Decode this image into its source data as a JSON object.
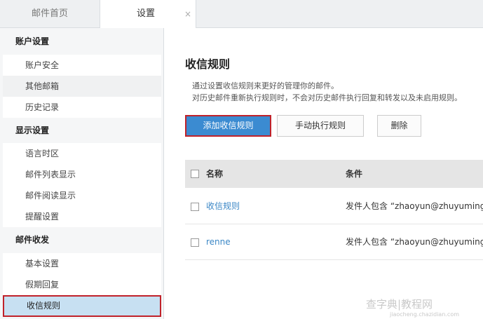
{
  "tabs": {
    "home": "邮件首页",
    "settings": "设置",
    "close_glyph": "×"
  },
  "sidebar": {
    "groups": [
      {
        "heading": "账户设置",
        "items": [
          "账户安全",
          "其他邮箱",
          "历史记录"
        ]
      },
      {
        "heading": "显示设置",
        "items": [
          "语言时区",
          "邮件列表显示",
          "邮件阅读显示",
          "提醒设置"
        ]
      },
      {
        "heading": "邮件收发",
        "items": [
          "基本设置",
          "假期回复",
          "收信规则"
        ]
      }
    ],
    "active_item": "收信规则",
    "highlight_color": "#c7e0f2"
  },
  "main": {
    "title": "收信规则",
    "desc_line1": "通过设置收信规则来更好的管理你的邮件。",
    "desc_line2": "对历史邮件重新执行规则时，不会对历史邮件执行回复和转发以及未启用规则。",
    "buttons": {
      "add": "添加收信规则",
      "manual": "手动执行规则",
      "delete": "删除"
    },
    "table": {
      "columns": [
        "名称",
        "条件"
      ],
      "rows": [
        {
          "name": "收信规则",
          "condition": "发件人包含 “zhaoyun@zhuyuming.so"
        },
        {
          "name": "renne",
          "condition": "发件人包含 “zhaoyun@zhuyuming.so"
        }
      ]
    }
  },
  "watermark": {
    "text": "查字典|教程网",
    "sub": "jiaocheng.chazidian.com"
  },
  "colors": {
    "accent": "#3b8bd1",
    "callout_red": "#c0222a",
    "link": "#3b87c6"
  }
}
